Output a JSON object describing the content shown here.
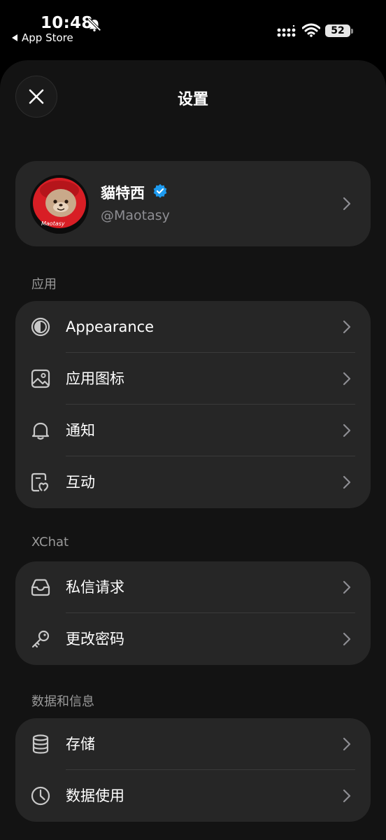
{
  "status_bar": {
    "time": "10:48",
    "back_app": "App Store",
    "battery": "52",
    "icons": [
      "bell-slash-icon",
      "signal-icon",
      "wifi-icon",
      "battery-icon"
    ]
  },
  "header": {
    "title": "设置",
    "close_icon": "close-icon"
  },
  "profile": {
    "name": "貓特西",
    "handle": "@Maotasy",
    "avatar_text": "Maotasy",
    "verified_color": "#1d9bf0"
  },
  "sections": [
    {
      "label": "应用",
      "items": [
        {
          "label": "Appearance",
          "icon": "appearance-icon"
        },
        {
          "label": "应用图标",
          "icon": "image-icon"
        },
        {
          "label": "通知",
          "icon": "bell-icon"
        },
        {
          "label": "互动",
          "icon": "interaction-icon"
        }
      ]
    },
    {
      "label": "XChat",
      "items": [
        {
          "label": "私信请求",
          "icon": "inbox-icon"
        },
        {
          "label": "更改密码",
          "icon": "key-icon"
        }
      ]
    },
    {
      "label": "数据和信息",
      "items": [
        {
          "label": "存储",
          "icon": "database-icon"
        },
        {
          "label": "数据使用",
          "icon": "clock-icon"
        }
      ]
    }
  ],
  "colors": {
    "background": "#000000",
    "sheet": "#131313",
    "card": "#262626",
    "accent": "#1d9bf0",
    "avatar_red": "#d81e25"
  }
}
